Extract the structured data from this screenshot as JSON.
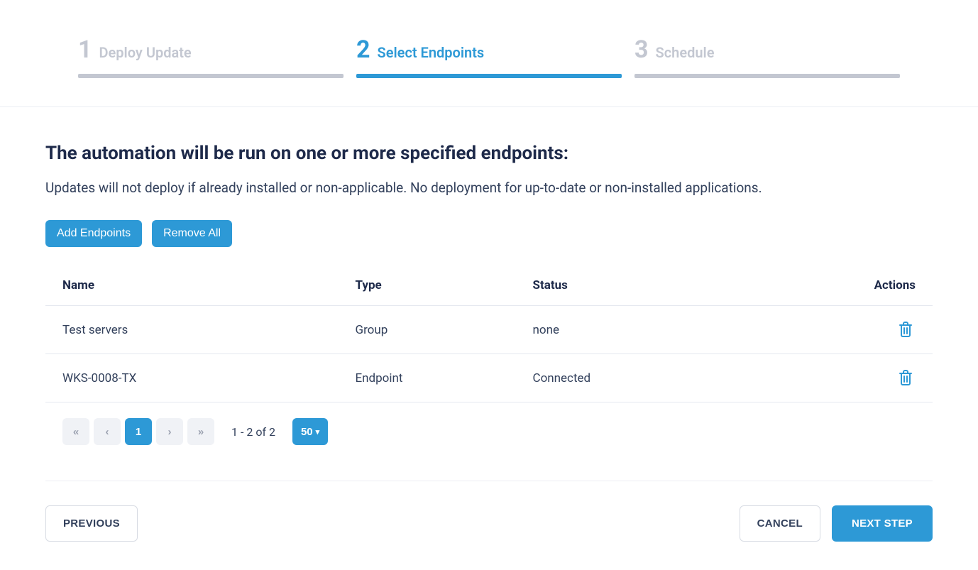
{
  "stepper": {
    "steps": [
      {
        "num": "1",
        "label": "Deploy Update",
        "active": false
      },
      {
        "num": "2",
        "label": "Select Endpoints",
        "active": true
      },
      {
        "num": "3",
        "label": "Schedule",
        "active": false
      }
    ]
  },
  "main": {
    "heading": "The automation will be run on one or more specified endpoints:",
    "subtext": "Updates will not deploy if already installed or non-applicable. No deployment for up-to-date or non-installed applications.",
    "actions": {
      "add": "Add Endpoints",
      "remove": "Remove All"
    },
    "table": {
      "columns": {
        "name": "Name",
        "type": "Type",
        "status": "Status",
        "actions": "Actions"
      },
      "rows": [
        {
          "name": "Test servers",
          "type": "Group",
          "status": "none"
        },
        {
          "name": "WKS-0008-TX",
          "type": "Endpoint",
          "status": "Connected"
        }
      ]
    },
    "pagination": {
      "first": "«",
      "prev": "‹",
      "current": "1",
      "next": "›",
      "last": "»",
      "info": "1 - 2 of 2",
      "page_size": "50"
    }
  },
  "footer": {
    "previous": "PREVIOUS",
    "cancel": "CANCEL",
    "next": "NEXT STEP"
  },
  "colors": {
    "accent": "#2d99d6",
    "muted": "#c3c7d1",
    "text": "#1e2a4a"
  }
}
